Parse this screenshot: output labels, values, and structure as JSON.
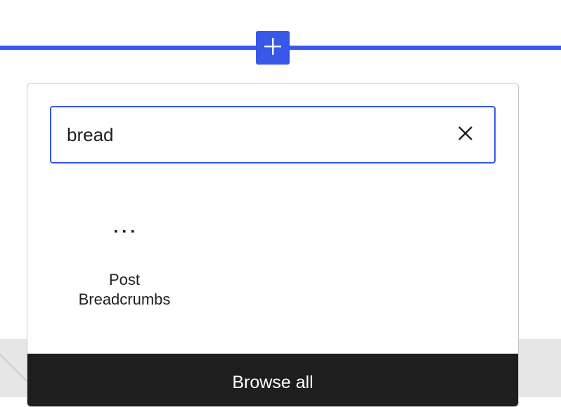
{
  "inserter": {
    "toggle_icon": "plus-icon",
    "accent_color": "#3858e9"
  },
  "search": {
    "value": "bread",
    "clear_icon": "close-icon"
  },
  "results": [
    {
      "label": "Post Breadcrumbs",
      "icon": "more-horizontal-icon"
    }
  ],
  "footer": {
    "browse_all_label": "Browse all"
  }
}
